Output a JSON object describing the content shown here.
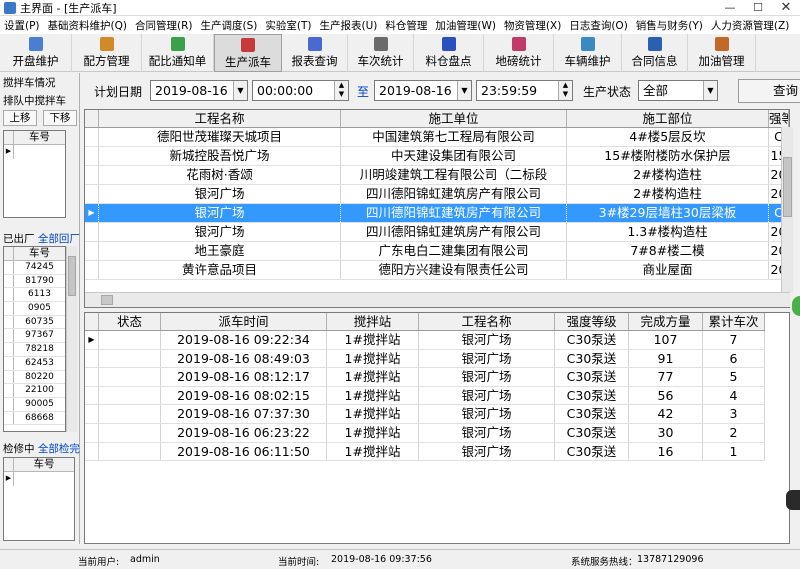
{
  "window": {
    "title": "主界面 - [生产派车]"
  },
  "menu": [
    "设置(P)",
    "基础资料维护(Q)",
    "合同管理(R)",
    "生产调度(S)",
    "实验室(T)",
    "生产报表(U)",
    "料仓管理",
    "加油管理(W)",
    "物资管理(X)",
    "日志查询(O)",
    "销售与财务(Y)",
    "人力资源管理(Z)"
  ],
  "toolbar": [
    {
      "label": "开盘维护",
      "color": "#4a7fd0"
    },
    {
      "label": "配方管理",
      "color": "#d08a2a"
    },
    {
      "label": "配比通知单",
      "color": "#3aa04a"
    },
    {
      "label": "生产派车",
      "color": "#c83a3a"
    },
    {
      "label": "报表查询",
      "color": "#4a6ad0"
    },
    {
      "label": "车次统计",
      "color": "#6a6a6a"
    },
    {
      "label": "料仓盘点",
      "color": "#2a50c0"
    },
    {
      "label": "地磅统计",
      "color": "#c03a6a"
    },
    {
      "label": "车辆维护",
      "color": "#3a8ac0"
    },
    {
      "label": "合同信息",
      "color": "#2a60b0"
    },
    {
      "label": "加油管理",
      "color": "#c06a2a"
    }
  ],
  "left": {
    "group_title": "搅拌车情况",
    "queue_label": "排队中搅拌车",
    "up_btn": "上移",
    "down_btn": "下移",
    "col_car": "车号",
    "out_label": "已出厂",
    "out_all": "全部回厂",
    "out_cars": [
      "74245",
      "81790",
      "6113",
      "0905",
      "60735",
      "97367",
      "78218",
      "62453",
      "80220",
      "22100",
      "90005",
      "68668"
    ],
    "repair_label": "检修中",
    "repair_all": "全部检完"
  },
  "filter": {
    "plan_date_label": "计划日期",
    "date_from": "2019-08-16",
    "time_from": "00:00:00",
    "to_label": "至",
    "date_to": "2019-08-16",
    "time_to": "23:59:59",
    "status_label": "生产状态",
    "status_value": "全部",
    "query_btn": "查询"
  },
  "top_grid": {
    "columns": [
      "工程名称",
      "施工单位",
      "施工部位",
      "强等"
    ],
    "rows": [
      [
        "德阳世茂璀璨天城项目",
        "中国建筑第七工程局有限公司",
        "4#楼5层反坎",
        "C"
      ],
      [
        "新城控股吾悦广场",
        "中天建设集团有限公司",
        "15#楼附楼防水保护层",
        "15"
      ],
      [
        "花雨树·香颂",
        "川明竣建筑工程有限公司（二标段",
        "2#楼构造柱",
        "20"
      ],
      [
        "银河广场",
        "四川德阳锦虹建筑房产有限公司",
        "2#楼构造柱",
        "20"
      ],
      [
        "银河广场",
        "四川德阳锦虹建筑房产有限公司",
        "3#楼29层墙柱30层梁板",
        "C"
      ],
      [
        "银河广场",
        "四川德阳锦虹建筑房产有限公司",
        "1.3#楼构造柱",
        "20"
      ],
      [
        "地王豪庭",
        "广东电白二建集团有限公司",
        "7#8#楼二模",
        "20"
      ],
      [
        "黄许意品项目",
        "德阳方兴建设有限责任公司",
        "商业屋面",
        "20"
      ]
    ],
    "selected_row": 4
  },
  "bottom_grid": {
    "columns": [
      "状态",
      "派车时间",
      "搅拌站",
      "工程名称",
      "强度等级",
      "完成方量",
      "累计车次"
    ],
    "rows": [
      [
        "",
        "2019-08-16 09:22:34",
        "1#搅拌站",
        "银河广场",
        "C30泵送",
        "107",
        "7"
      ],
      [
        "",
        "2019-08-16 08:49:03",
        "1#搅拌站",
        "银河广场",
        "C30泵送",
        "91",
        "6"
      ],
      [
        "",
        "2019-08-16 08:12:17",
        "1#搅拌站",
        "银河广场",
        "C30泵送",
        "77",
        "5"
      ],
      [
        "",
        "2019-08-16 08:02:15",
        "1#搅拌站",
        "银河广场",
        "C30泵送",
        "56",
        "4"
      ],
      [
        "",
        "2019-08-16 07:37:30",
        "1#搅拌站",
        "银河广场",
        "C30泵送",
        "42",
        "3"
      ],
      [
        "",
        "2019-08-16 06:23:22",
        "1#搅拌站",
        "银河广场",
        "C30泵送",
        "30",
        "2"
      ],
      [
        "",
        "2019-08-16 06:11:50",
        "1#搅拌站",
        "银河广场",
        "C30泵送",
        "16",
        "1"
      ]
    ]
  },
  "status": {
    "user_label": "当前用户:",
    "user": "admin",
    "time_label": "当前时间:",
    "time": "2019-08-16 09:37:56",
    "hotline_label": "系统服务热线：",
    "hotline": "13787129096"
  }
}
